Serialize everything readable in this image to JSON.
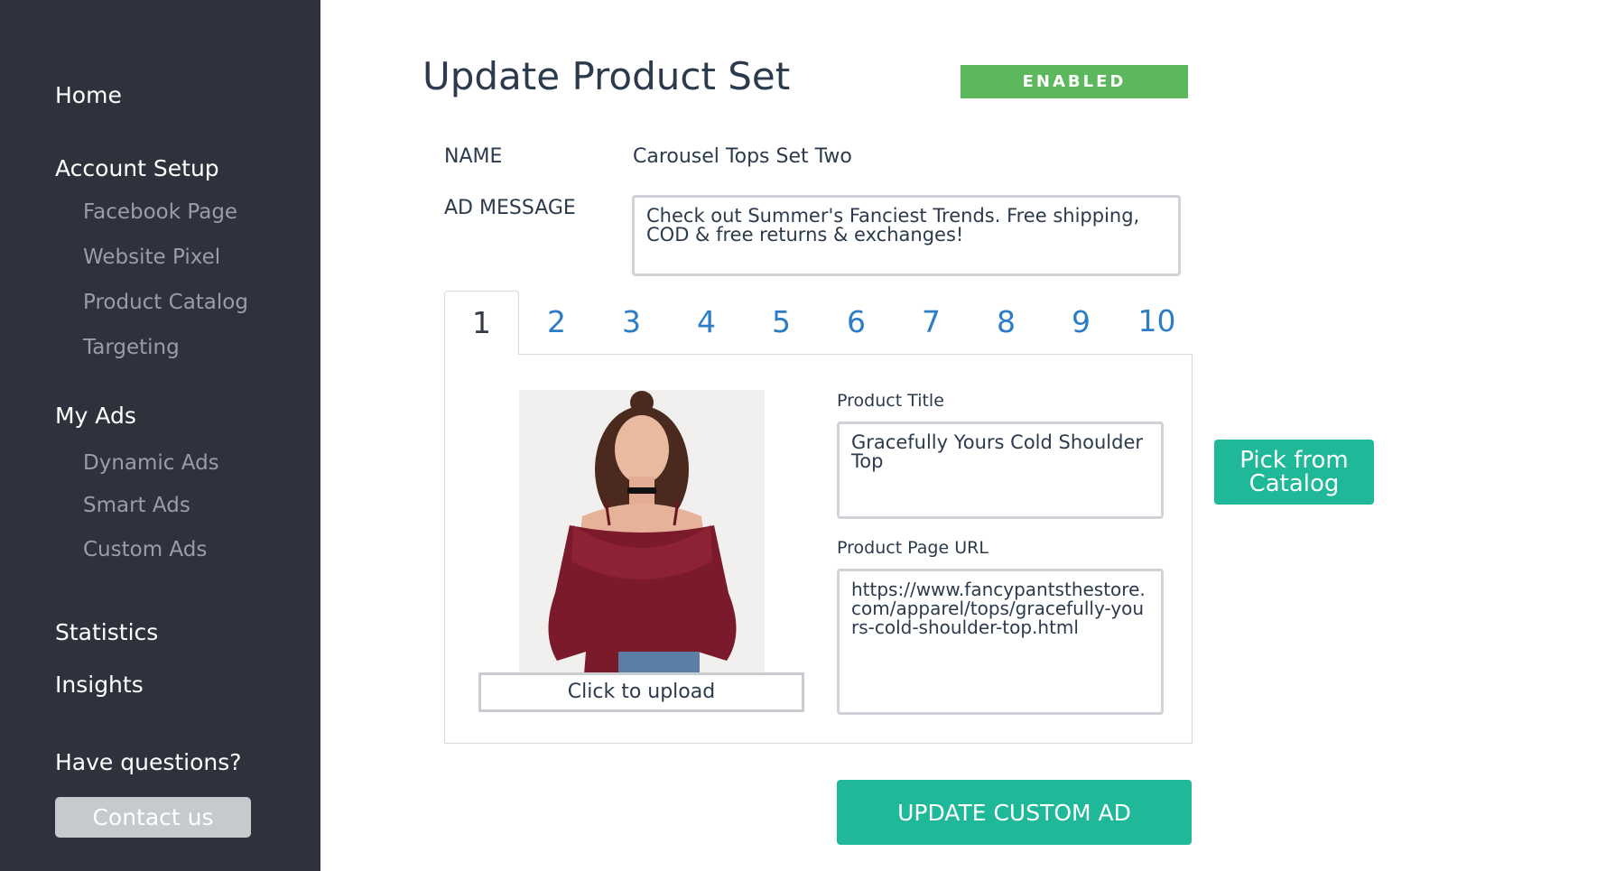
{
  "sidebar": {
    "home": "Home",
    "account_setup": {
      "label": "Account Setup",
      "items": [
        "Facebook Page",
        "Website Pixel",
        "Product Catalog",
        "Targeting"
      ]
    },
    "my_ads": {
      "label": "My Ads",
      "items": [
        "Dynamic Ads",
        "Smart Ads",
        "Custom Ads"
      ]
    },
    "statistics": "Statistics",
    "insights": "Insights",
    "help_heading": "Have questions?",
    "contact_button": "Contact us"
  },
  "main": {
    "title": "Update Product Set",
    "status": "ENABLED",
    "name_label": "NAME",
    "name_value": "Carousel Tops Set Two",
    "ad_message_label": "AD MESSAGE",
    "ad_message": "Check out Summer's Fanciest Trends. Free shipping, COD & free returns & exchanges!",
    "tabs": [
      "1",
      "2",
      "3",
      "4",
      "5",
      "6",
      "7",
      "8",
      "9",
      "10"
    ],
    "active_tab": "1",
    "product": {
      "title_label": "Product Title",
      "title_value": "Gracefully Yours Cold Shoulder Top",
      "url_label": "Product Page URL",
      "url_value": "https://www.fancypantsthestore.com/apparel/tops/gracefully-yours-cold-shoulder-top.html",
      "upload_label": "Click to upload"
    },
    "pick_button": "Pick from\nCatalog",
    "update_button": "UPDATE CUSTOM AD"
  },
  "colors": {
    "sidebar_bg": "#2f323c",
    "accent": "#1fb898",
    "status_green": "#5cb85c",
    "tab_link": "#2d7dc6"
  }
}
